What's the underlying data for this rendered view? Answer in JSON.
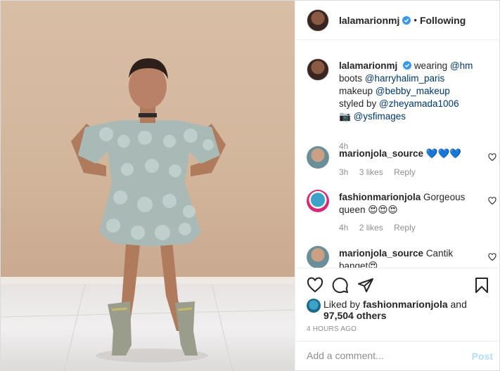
{
  "header": {
    "username": "lalamarionmj",
    "separator": "•",
    "follow_label": "Following"
  },
  "caption": {
    "username": "lalamarionmj",
    "line1": "wearing",
    "m1": "@hm",
    "line2": "boots",
    "m2": "@harryhalim_paris",
    "line3": "makeup",
    "m3": "@bebby_makeup",
    "line4": "styled by",
    "m4": "@zheyamada1006",
    "camera": "📷",
    "m5": "@ysfimages",
    "time": "4h"
  },
  "comments": [
    {
      "username": "marionjola_source",
      "text": "💙💙💙",
      "time": "3h",
      "likes": "3 likes",
      "reply": "Reply"
    },
    {
      "username": "fashionmarionjola",
      "text": "Gorgeous queen 😍😍😍",
      "time": "4h",
      "likes": "2 likes",
      "reply": "Reply"
    },
    {
      "username": "marionjola_source",
      "text": "Cantik banget😍",
      "time": "",
      "likes": "",
      "reply": ""
    }
  ],
  "likes": {
    "prefix": "Liked by",
    "user": "fashionmarionjola",
    "and": "and",
    "count": "97,504 others"
  },
  "timestamp": "4 HOURS AGO",
  "add_comment": {
    "placeholder": "Add a comment...",
    "post_label": "Post"
  },
  "icons": [
    "heart-icon",
    "comment-icon",
    "share-icon",
    "bookmark-icon",
    "verified-icon"
  ],
  "colors": {
    "verified": "#3897f0",
    "link": "#00376b",
    "post_disabled": "#b2dffc",
    "muted": "#8e8e8e"
  }
}
